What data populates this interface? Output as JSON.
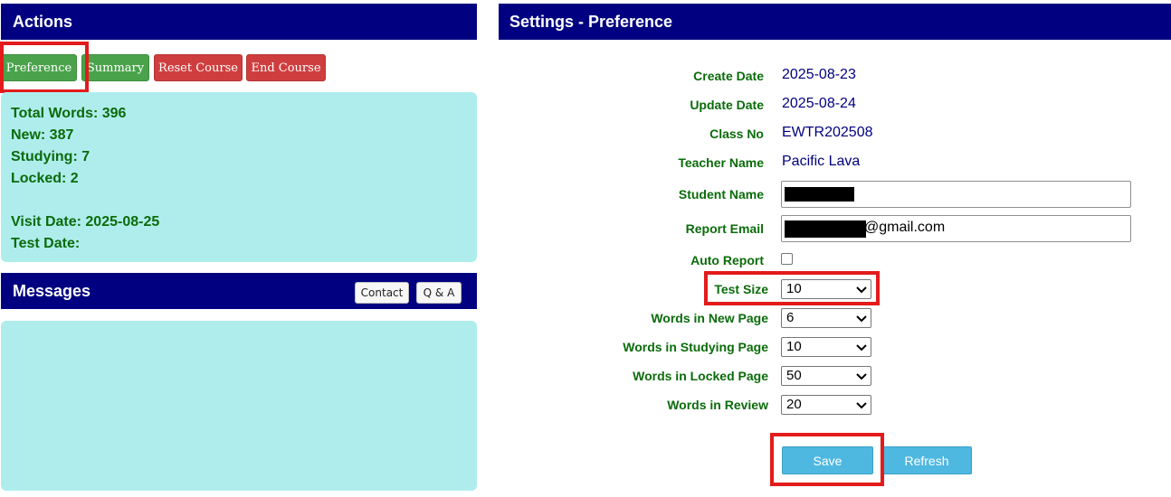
{
  "actions": {
    "title": "Actions",
    "buttons": {
      "preference": "Preference",
      "summary": "Summary",
      "reset_course": "Reset Course",
      "end_course": "End Course"
    },
    "stats": {
      "total_words": "Total Words: 396",
      "new": "New: 387",
      "studying": "Studying: 7",
      "locked": "Locked: 2",
      "visit_date": "Visit Date: 2025-08-25",
      "test_date": "Test Date:"
    }
  },
  "messages": {
    "title": "Messages",
    "contact_label": "Contact",
    "qa_label": "Q & A"
  },
  "settings": {
    "title": "Settings - Preference",
    "fields": {
      "create_date": {
        "label": "Create Date",
        "value": "2025-08-23"
      },
      "update_date": {
        "label": "Update Date",
        "value": "2025-08-24"
      },
      "class_no": {
        "label": "Class No",
        "value": "EWTR202508"
      },
      "teacher_name": {
        "label": "Teacher Name",
        "value": "Pacific Lava"
      },
      "student_name": {
        "label": "Student Name"
      },
      "report_email": {
        "label": "Report Email",
        "visible_suffix": "@gmail.com"
      },
      "auto_report": {
        "label": "Auto Report",
        "checked": false
      },
      "test_size": {
        "label": "Test Size",
        "value": "10"
      },
      "words_new_page": {
        "label": "Words in New Page",
        "value": "6"
      },
      "words_studying_page": {
        "label": "Words in Studying Page",
        "value": "10"
      },
      "words_locked_page": {
        "label": "Words in Locked Page",
        "value": "50"
      },
      "words_review": {
        "label": "Words in Review",
        "value": "20"
      }
    },
    "save_label": "Save",
    "refresh_label": "Refresh"
  },
  "colors": {
    "header_bg": "#000080",
    "panel_bg": "#afeded",
    "label_green": "#0a6b0a",
    "value_navy": "#000080",
    "btn_green": "#4aa34a",
    "btn_red": "#cf3e3e",
    "btn_blue": "#4eb8e1",
    "highlight_red": "#e31b1b"
  },
  "icons": {
    "select_arrow": "chevron-down-icon"
  }
}
